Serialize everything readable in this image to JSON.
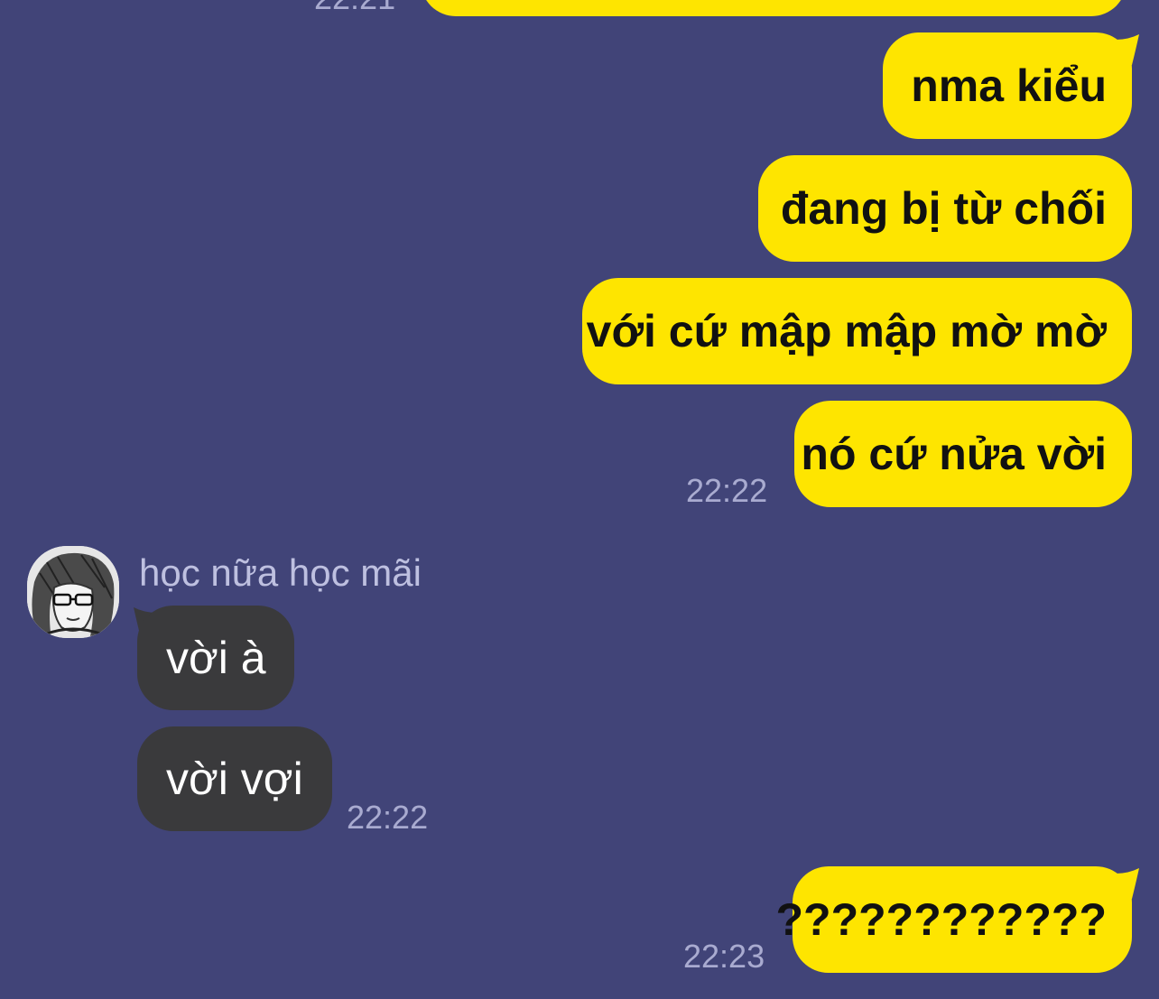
{
  "chat": {
    "top_partial_timestamp": "22:21",
    "outgoing_group_1": {
      "messages": [
        "nma kiểu",
        "đang bị từ chối",
        "với cứ mập mập mờ mờ",
        "nó cứ nửa vời"
      ],
      "timestamp": "22:22"
    },
    "incoming_group": {
      "sender_name": "học nữa học mãi",
      "avatar_icon": "manga-character-avatar",
      "messages": [
        "vời à",
        "vời vợi"
      ],
      "timestamp": "22:22"
    },
    "outgoing_group_2": {
      "messages": [
        "????????????"
      ],
      "timestamp": "22:23"
    }
  },
  "colors": {
    "background": "#414478",
    "outgoing_bubble": "#FEE500",
    "incoming_bubble": "#3A3A3C",
    "timestamp_text": "#A9ABD0",
    "sender_name_text": "#BEC0E0"
  }
}
